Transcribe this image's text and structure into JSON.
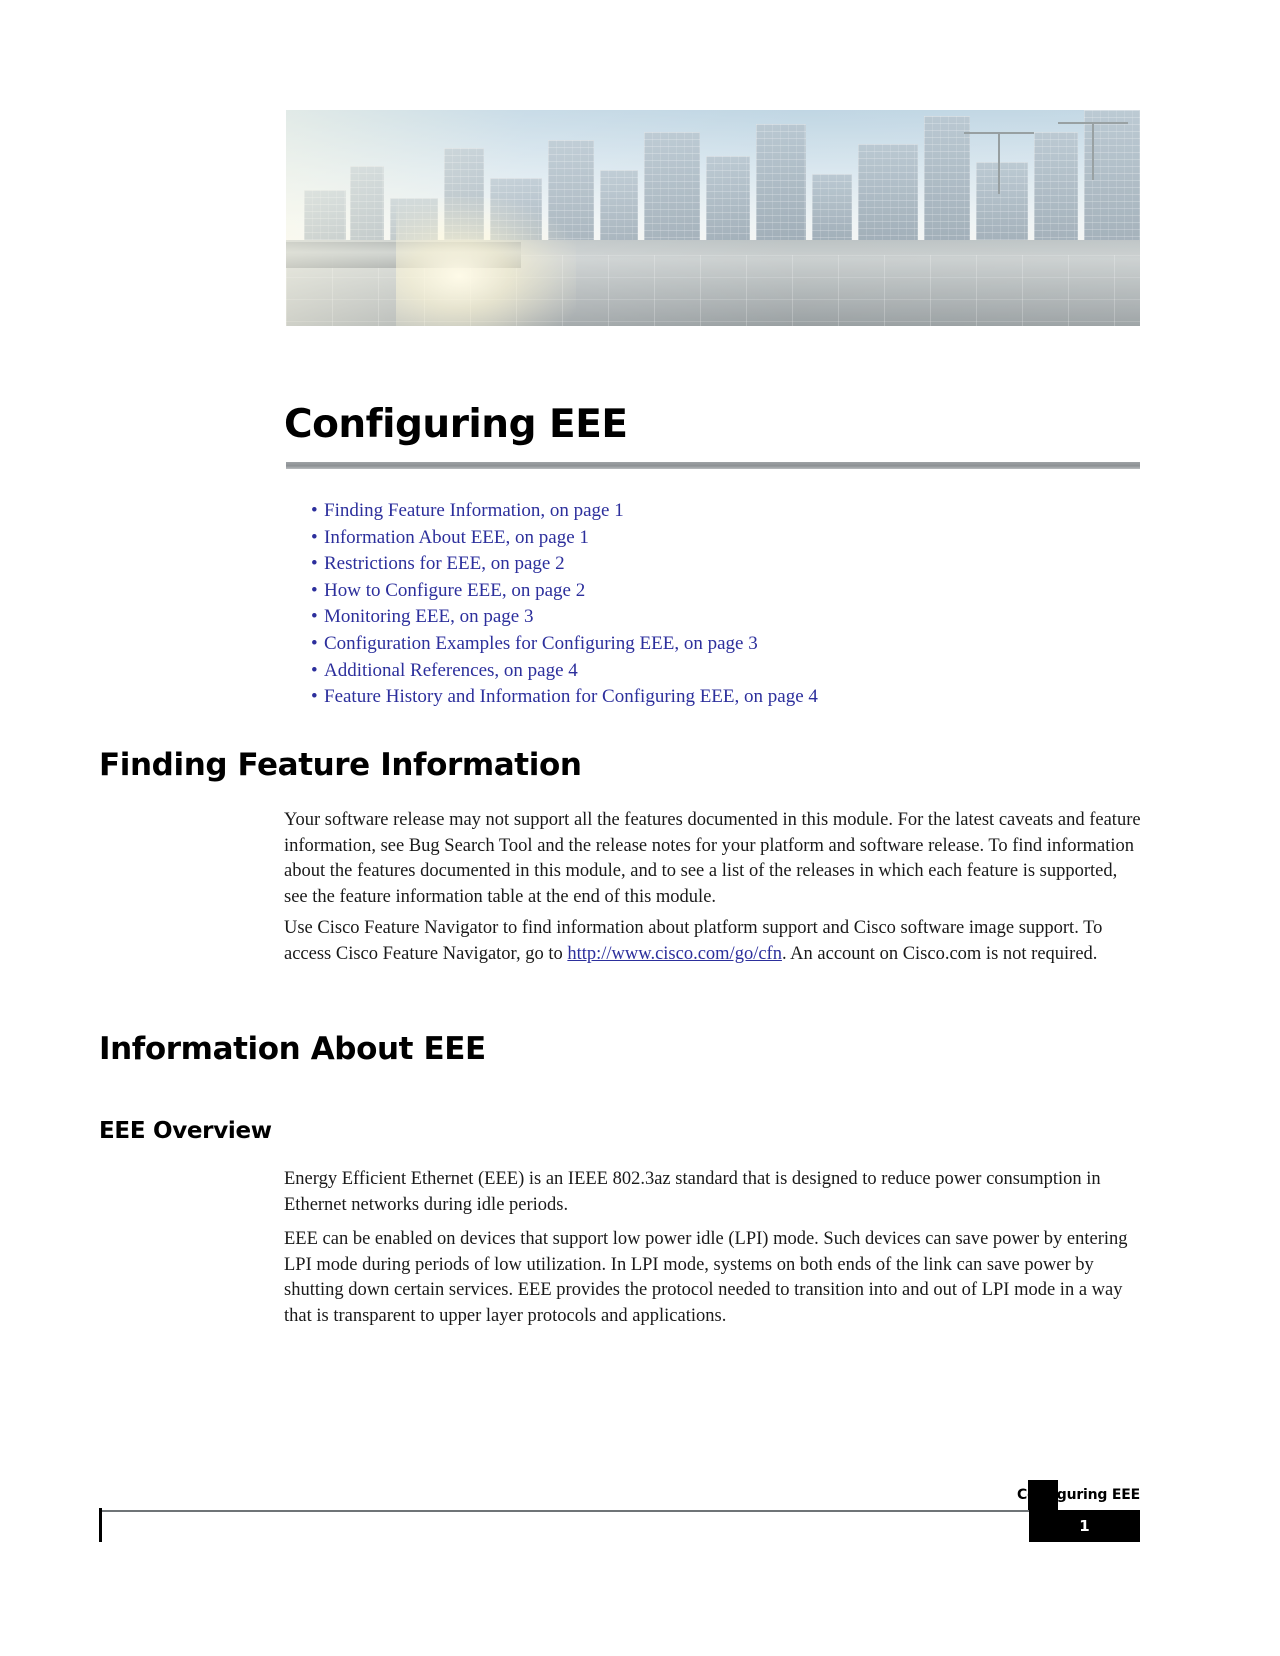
{
  "document": {
    "chapter_title": "Configuring EEE",
    "footer": {
      "title": "Configuring EEE",
      "page_number": "1"
    }
  },
  "toc": {
    "bullet": "•",
    "items": [
      {
        "label": "Finding Feature Information, on page 1"
      },
      {
        "label": "Information About EEE, on page 1"
      },
      {
        "label": "Restrictions for EEE, on page 2"
      },
      {
        "label": "How to Configure EEE, on page 2"
      },
      {
        "label": "Monitoring EEE, on page 3"
      },
      {
        "label": "Configuration Examples for Configuring EEE, on page 3"
      },
      {
        "label": "Additional References, on page 4"
      },
      {
        "label": "Feature History and Information for Configuring EEE, on page 4"
      }
    ]
  },
  "sections": {
    "finding_feature_information": {
      "heading": "Finding Feature Information",
      "paragraph_1": "Your software release may not support all the features documented in this module. For the latest caveats and feature information, see Bug Search Tool and the release notes for your platform and software release. To find information about the features documented in this module, and to see a list of the releases in which each feature is supported, see the feature information table at the end of this module.",
      "paragraph_2_before_link": "Use Cisco Feature Navigator to find information about platform support and Cisco software image support. To access Cisco Feature Navigator, go to ",
      "link_text": "http://www.cisco.com/go/cfn",
      "paragraph_2_after_link": ". An account on Cisco.com is not required."
    },
    "information_about_eee": {
      "heading": "Information About EEE",
      "subsection": {
        "heading": "EEE Overview",
        "paragraph_1": "Energy Efficient Ethernet (EEE) is an IEEE 802.3az standard that is designed to reduce power consumption in Ethernet networks during idle periods.",
        "paragraph_2": "EEE can be enabled on devices that support low power idle (LPI) mode. Such devices can save power by entering LPI mode during periods of low utilization. In LPI mode, systems on both ends of the link can save power by shutting down certain services. EEE provides the protocol needed to transition into and out of LPI mode in a way that is transparent to upper layer protocols and applications."
      }
    }
  },
  "colors": {
    "link": "#2c2f9c",
    "text": "#1a1a1a",
    "rule": "#9ea2a5"
  }
}
